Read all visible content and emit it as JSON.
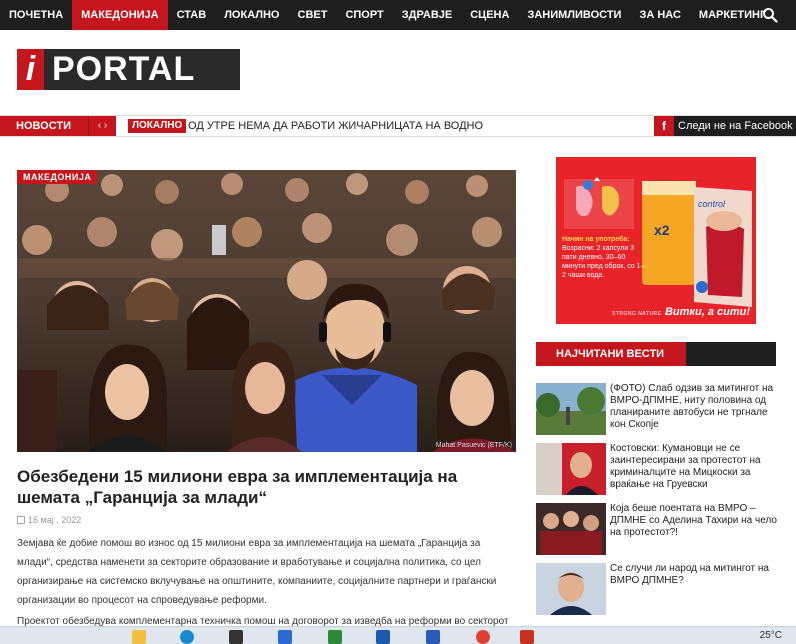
{
  "nav": {
    "items": [
      "ПОЧЕТНА",
      "МАКЕДОНИЈА",
      "СТАВ",
      "ЛОКАЛНО",
      "СВЕТ",
      "СПОРТ",
      "ЗДРАВЈЕ",
      "СЦЕНА",
      "ЗАНИМЛИВОСТИ",
      "ЗА НАС",
      "МАРКЕТИНГ"
    ],
    "active": "МАКЕДОНИЈА",
    "search_icon": "search-icon"
  },
  "logo": {
    "i": "i",
    "word": "PORTAL"
  },
  "ticker": {
    "label": "НОВОСТИ",
    "arrows": "‹ ›",
    "tag": "ЛОКАЛНО",
    "headline": "ОД УТРЕ НЕМА ДА РАБОТИ ЖИЧАРНИЦАТА НА ВОДНО",
    "facebook_icon": "f",
    "facebook_text": "Следи не на Facebook"
  },
  "article": {
    "category": "МАКЕДОНИЈА",
    "image_credit": "Mahat Pasuevic (ETF/K)",
    "title": "Обезбедени 15 милиони евра за имплементација на шемата „Гаранција за млади“",
    "date": "16 мај , 2022",
    "body": "Земјава ќе добие помош во износ од 15 милиони евра за имплементација на шемата „Гаранција за млади“, средства наменети за секторите образование и вработување и социјална политика, со цел организирање на системско вклучување на општините, компаниите, социјалните партнери и граѓански организации во процесот на спроведување реформи.",
    "body_cut": "Проектот обезбедува комплементарна техничка помош на договорот за изведба на реформи во секторот"
  },
  "ad": {
    "heading": "Начин на употреба:",
    "text": "Возрасни: 2 капсули 3 пати дневно, 30–60 минути пред оброк, со 1–2 чаши вода.",
    "badge": "x2",
    "brand": "STRONG NATURE",
    "slogan": "Витки, а сити!",
    "product": "control"
  },
  "most_read": {
    "title": "НАЈЧИТАНИ ВЕСТИ",
    "items": [
      {
        "text": "(ФОТО) Слаб одзив за митингот на ВМРО-ДПМНЕ, ниту половина од планираните автобуси не тргнале кон Скопје"
      },
      {
        "text": "Костовски: Кумановци не се заинтересирани за протестот на криминалците на Мицкоски за враќање на Груевски"
      },
      {
        "text": "Која беше поентата на ВМРО – ДПМНЕ со Аделина Тахири на чело на протестот?!"
      },
      {
        "text": "Се случи ли народ на митингот на ВМРО ДПМНЕ?"
      }
    ]
  },
  "taskbar": {
    "weather": "25°C"
  },
  "colors": {
    "accent": "#c4161c",
    "dark": "#1e1e1e"
  }
}
